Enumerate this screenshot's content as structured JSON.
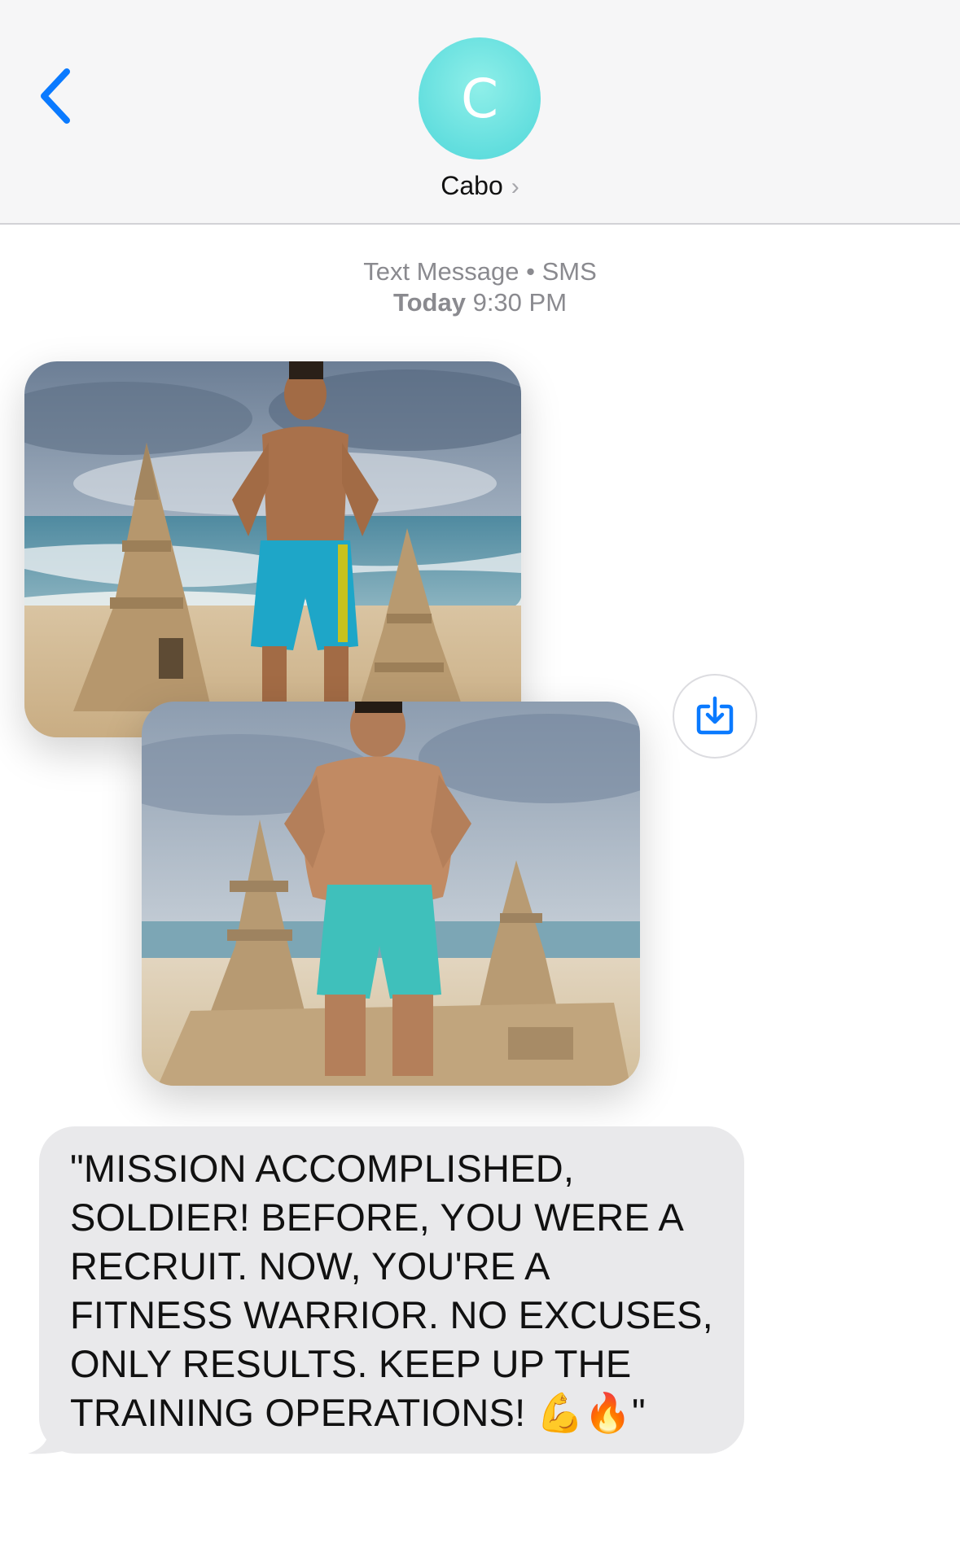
{
  "header": {
    "avatar_initial": "C",
    "contact_name": "Cabo",
    "contact_chevron": "›"
  },
  "meta": {
    "service_label": "Text Message",
    "service_sep": "•",
    "service_type": "SMS",
    "day": "Today",
    "time": "9:30 PM"
  },
  "message": {
    "text": "\"MISSION ACCOMPLISHED, SOLDIER! BEFORE, YOU WERE A RECRUIT. NOW, YOU'RE A FITNESS WARRIOR. NO EXCUSES, ONLY RESULTS. KEEP UP THE TRAINING OPERATIONS! 💪🔥\""
  },
  "icons": {
    "back": "chevron-left-icon",
    "save": "download-icon"
  },
  "colors": {
    "accent": "#0a7aff",
    "avatar": "#62dede",
    "bubble": "#e9e9eb",
    "header_bg": "#f6f6f7"
  }
}
